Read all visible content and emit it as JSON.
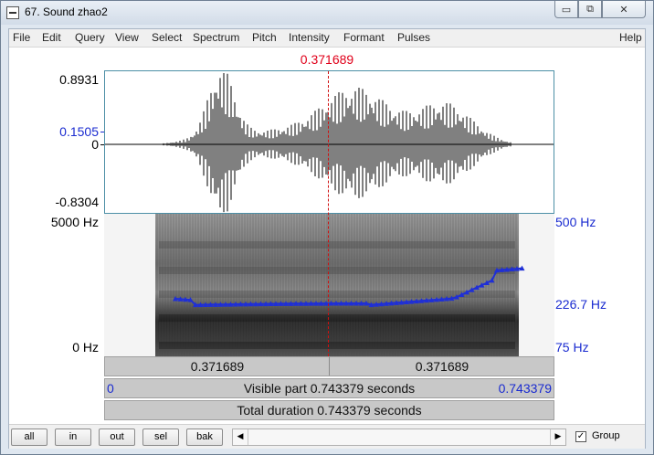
{
  "window": {
    "title": "67. Sound zhao2",
    "min_glyph": "▭",
    "max_glyph": "⧉",
    "close_glyph": "✕"
  },
  "menu": [
    "File",
    "Edit",
    "Query",
    "View",
    "Select",
    "Spectrum",
    "Pitch",
    "Intensity",
    "Formant",
    "Pulses"
  ],
  "menu_help": "Help",
  "cursor": {
    "time": "0.371689"
  },
  "waveform": {
    "y_max": "0.8931",
    "y_cursor": "0.1505",
    "y_zero": "0",
    "y_min": "-0.8304"
  },
  "spectrogram": {
    "freq_top": "5000 Hz",
    "freq_bottom": "0 Hz"
  },
  "pitch": {
    "top": "500 Hz",
    "cursor_value": "226.7 Hz",
    "bottom": "75 Hz",
    "color": "#1f2fd6"
  },
  "bars": {
    "left_segment": "0.371689",
    "right_segment": "0.371689",
    "visible_start": "0",
    "visible_label": "Visible part 0.743379 seconds",
    "visible_end": "0.743379",
    "total_label": "Total duration 0.743379 seconds"
  },
  "toolbar": {
    "buttons": [
      "all",
      "in",
      "out",
      "sel",
      "bak"
    ],
    "scroll_left": "◀",
    "scroll_right": "▶",
    "group_label": "Group",
    "group_checked": "✓"
  }
}
